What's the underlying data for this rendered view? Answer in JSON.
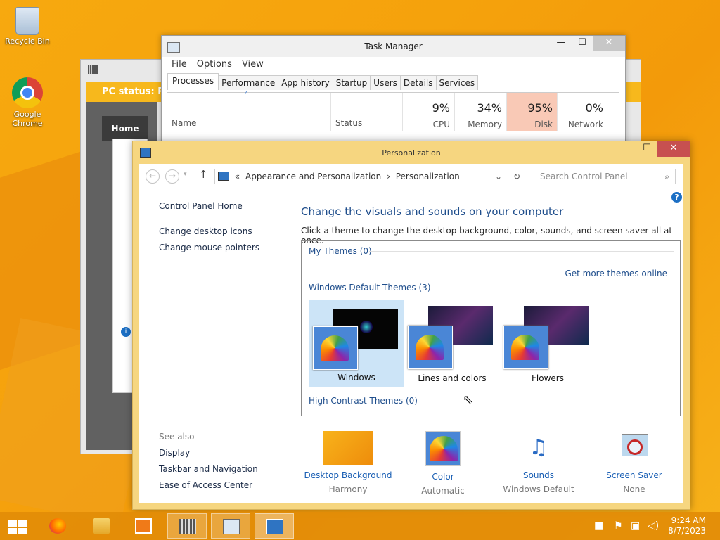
{
  "desktop": {
    "icons": [
      {
        "label": "Recycle Bin"
      },
      {
        "label": "Google Chrome"
      }
    ]
  },
  "background_app": {
    "status_text": "PC status: Pot",
    "home_label": "Home"
  },
  "task_manager": {
    "title": "Task Manager",
    "menu": [
      "File",
      "Options",
      "View"
    ],
    "tabs": [
      "Processes",
      "Performance",
      "App history",
      "Startup",
      "Users",
      "Details",
      "Services"
    ],
    "columns": {
      "name": "Name",
      "status": "Status",
      "cpu": {
        "pct": "9%",
        "label": "CPU"
      },
      "memory": {
        "pct": "34%",
        "label": "Memory"
      },
      "disk": {
        "pct": "95%",
        "label": "Disk"
      },
      "network": {
        "pct": "0%",
        "label": "Network"
      }
    }
  },
  "personalization": {
    "title": "Personalization",
    "breadcrumb": {
      "root": "Appearance and Personalization",
      "current": "Personalization",
      "separator_prefix": "«"
    },
    "search_placeholder": "Search Control Panel",
    "left_nav": {
      "home": "Control Panel Home",
      "links": [
        "Change desktop icons",
        "Change mouse pointers"
      ],
      "see_also_label": "See also",
      "see_also": [
        "Display",
        "Taskbar and Navigation",
        "Ease of Access Center"
      ]
    },
    "heading": "Change the visuals and sounds on your computer",
    "subtext": "Click a theme to change the desktop background, color, sounds, and screen saver all at once.",
    "my_themes": "My Themes (0)",
    "get_more": "Get more themes online",
    "default_themes": "Windows Default Themes (3)",
    "themes": [
      "Windows",
      "Lines and colors",
      "Flowers"
    ],
    "high_contrast": "High Contrast Themes (0)",
    "bottom": [
      {
        "label": "Desktop Background",
        "value": "Harmony"
      },
      {
        "label": "Color",
        "value": "Automatic"
      },
      {
        "label": "Sounds",
        "value": "Windows Default"
      },
      {
        "label": "Screen Saver",
        "value": "None"
      }
    ]
  },
  "taskbar": {
    "time": "9:24 AM",
    "date": "8/7/2023"
  },
  "colors": {
    "accent": "#f7a90f",
    "link": "#1a5fb4",
    "close_red": "#c75050",
    "disk_highlight": "#f9c9b6"
  }
}
